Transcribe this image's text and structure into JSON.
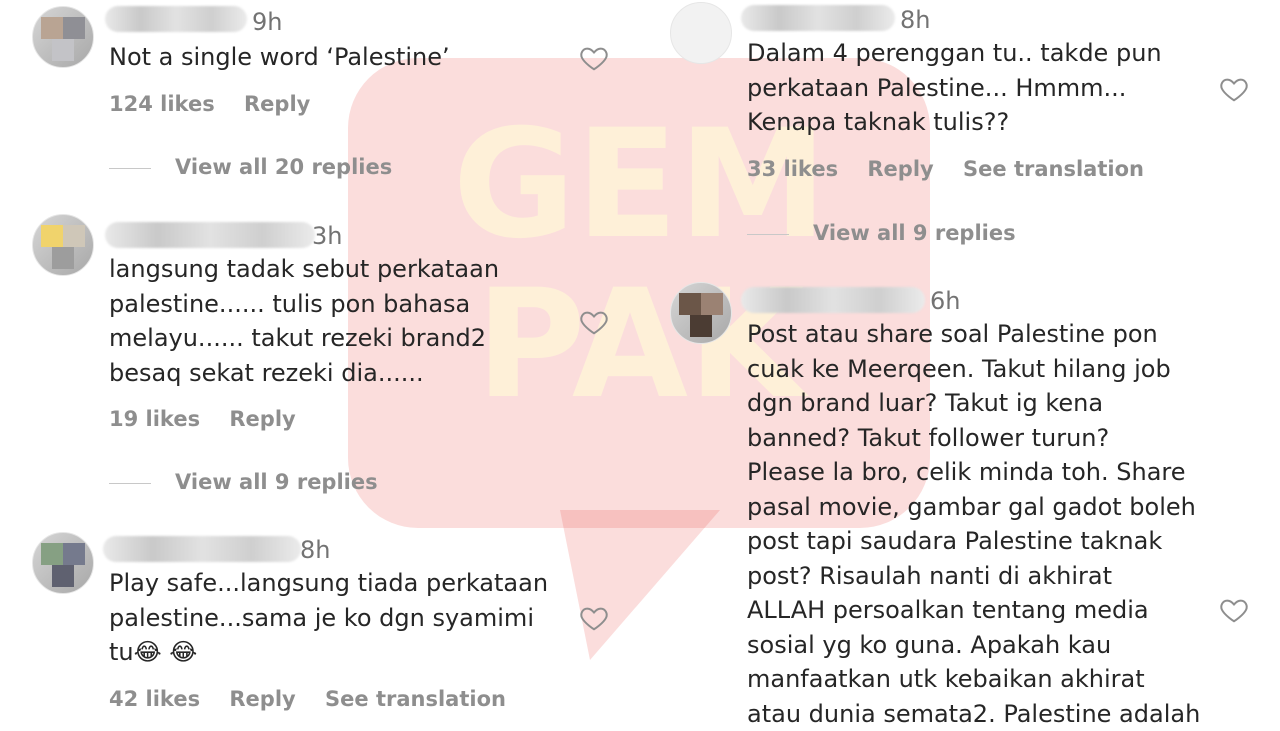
{
  "watermark": {
    "lines": [
      "GEM",
      "PAK"
    ],
    "color": "#e8403f"
  },
  "colors": {
    "meta": "#8e8e8e",
    "text": "#262626"
  },
  "comments": [
    {
      "time": "9h",
      "lines": [
        "Not a single word ‘Palestine’"
      ],
      "likes": "124 likes",
      "reply": "Reply",
      "view_replies": "View all 20 replies"
    },
    {
      "time": "3h",
      "lines": [
        "langsung tadak sebut perkataan",
        "palestine...... tulis pon bahasa",
        "melayu...... takut rezeki brand2",
        "besaq sekat rezeki dia......"
      ],
      "likes": "19 likes",
      "reply": "Reply",
      "view_replies": "View all 9 replies"
    },
    {
      "time": "8h",
      "lines": [
        "Play safe...langsung tiada perkataan",
        "palestine...sama je ko dgn syamimi",
        "tu😂 😂"
      ],
      "likes": "42 likes",
      "reply": "Reply",
      "translation": "See translation"
    },
    {
      "time": "8h",
      "lines": [
        "Dalam 4 perenggan tu.. takde pun",
        "perkataan Palestine... Hmmm...",
        "Kenapa taknak tulis??"
      ],
      "likes": "33 likes",
      "reply": "Reply",
      "translation": "See translation",
      "view_replies": "View all 9 replies"
    },
    {
      "time": "6h",
      "lines": [
        "Post atau share soal Palestine pon",
        "cuak ke Meerqeen. Takut hilang job",
        "dgn brand luar? Takut ig kena",
        "banned? Takut follower turun?",
        "Please la bro, celik minda toh. Share",
        "pasal movie, gambar gal gadot boleh",
        "post tapi saudara Palestine taknak",
        "post? Risaulah nanti di akhirat",
        "ALLAH persoalkan tentang media",
        "sosial yg ko guna. Apakah kau",
        "manfaatkan utk kebaikan akhirat",
        "atau dunia semata2. Palestine adalah"
      ]
    }
  ]
}
